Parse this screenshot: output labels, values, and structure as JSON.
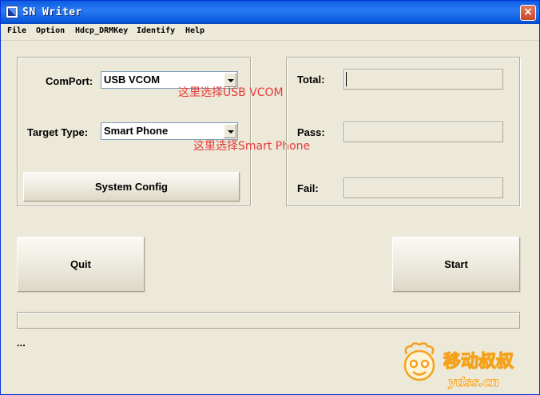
{
  "window": {
    "title": "SN Writer",
    "close": "×"
  },
  "menu": [
    "File",
    "Option",
    "Hdcp_DRMKey",
    "Identify",
    "Help"
  ],
  "config": {
    "comport_label": "ComPort:",
    "comport_value": "USB VCOM",
    "comport_note": "这里选择USB VCOM",
    "target_label": "Target Type:",
    "target_value": "Smart Phone",
    "target_note": "这里选择Smart Phone",
    "system_config": "System Config"
  },
  "stats": {
    "total_label": "Total:",
    "total_value": "",
    "pass_label": "Pass:",
    "pass_value": "",
    "fail_label": "Fail:",
    "fail_value": ""
  },
  "actions": {
    "quit": "Quit",
    "start": "Start"
  },
  "status_text": "...",
  "watermark": {
    "brand": "移动叔叔",
    "site": "ydss.cn"
  },
  "colors": {
    "titlebar": "#0a5ee0",
    "annotation": "#e83a3a",
    "watermark": "#f4a21c",
    "face": "#ece9d8"
  }
}
